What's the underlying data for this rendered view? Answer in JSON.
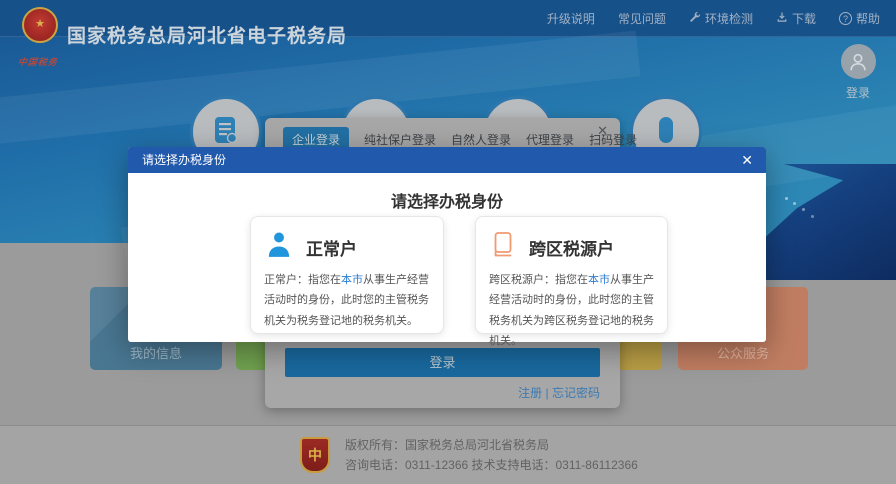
{
  "header": {
    "title": "国家税务总局河北省电子税务局",
    "emblem_script": "中国税务",
    "nav": [
      {
        "label": "升级说明"
      },
      {
        "label": "常见问题"
      },
      {
        "label": "环境检测",
        "icon": "wrench-icon"
      },
      {
        "label": "下载",
        "icon": "download-icon"
      },
      {
        "label": "帮助",
        "icon": "help-icon"
      }
    ],
    "help_badge": "?",
    "user_login_label": "登录"
  },
  "login_panel": {
    "tabs": [
      {
        "label": "企业登录",
        "active": true
      },
      {
        "label": "纯社保户登录"
      },
      {
        "label": "自然人登录"
      },
      {
        "label": "代理登录"
      },
      {
        "label": "扫码登录"
      }
    ],
    "close_label": "✕",
    "login_button": "登录",
    "register_link": "注册",
    "divider": "|",
    "forgot_link": "忘记密码"
  },
  "service_cards": {
    "left": "我的信息",
    "right": "公众服务"
  },
  "modal": {
    "titlebar": "请选择办税身份",
    "close_label": "✕",
    "heading": "请选择办税身份",
    "options": [
      {
        "title": "正常户",
        "desc_pre": "正常户：指您在",
        "desc_link": "本市",
        "desc_post": "从事生产经营活动时的身份，此时您的主管税务机关为税务登记地的税务机关。"
      },
      {
        "title": "跨区税源户",
        "desc_pre": "跨区税源户：指您在",
        "desc_link": "本市",
        "desc_post": "从事生产经营活动时的身份，此时您的主管税务机关为跨区税务登记地的税务机关。"
      }
    ]
  },
  "footer": {
    "badge_glyph": "中",
    "line1": "版权所有：国家税务总局河北省税务局",
    "line2": "咨询电话：0311-12366  技术支持电话：0311-86112366"
  },
  "colors": {
    "modal_header": "#2159ac",
    "accent_blue": "#2d7dd2",
    "person_icon": "#2196dc",
    "book_icon": "#f09a72"
  }
}
